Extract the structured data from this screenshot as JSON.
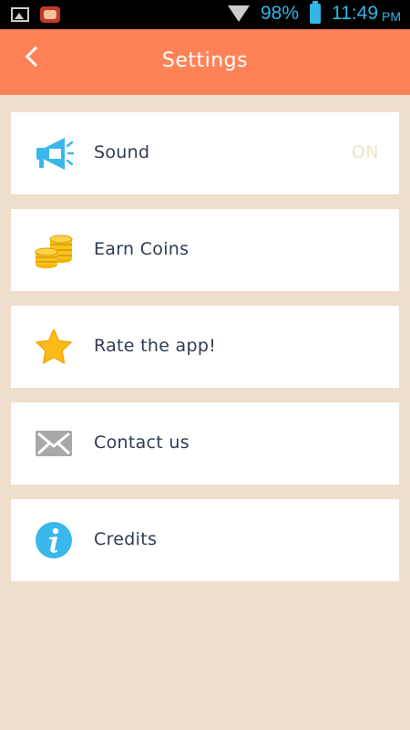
{
  "status_bar": {
    "battery_percent": "98%",
    "time": "11:49",
    "ampm": "PM",
    "color": "#33b5e5"
  },
  "header": {
    "title": "Settings",
    "back_icon": "chevron-left-icon",
    "color": "#ff8257"
  },
  "settings": {
    "items": [
      {
        "label": "Sound",
        "value": "ON",
        "icon": "megaphone-icon"
      },
      {
        "label": "Earn Coins",
        "icon": "coins-icon"
      },
      {
        "label": "Rate the app!",
        "icon": "star-icon"
      },
      {
        "label": "Contact us",
        "icon": "envelope-icon"
      },
      {
        "label": "Credits",
        "icon": "info-icon"
      }
    ]
  },
  "colors": {
    "background": "#efdecb",
    "card": "#ffffff",
    "label": "#2e3b52"
  }
}
